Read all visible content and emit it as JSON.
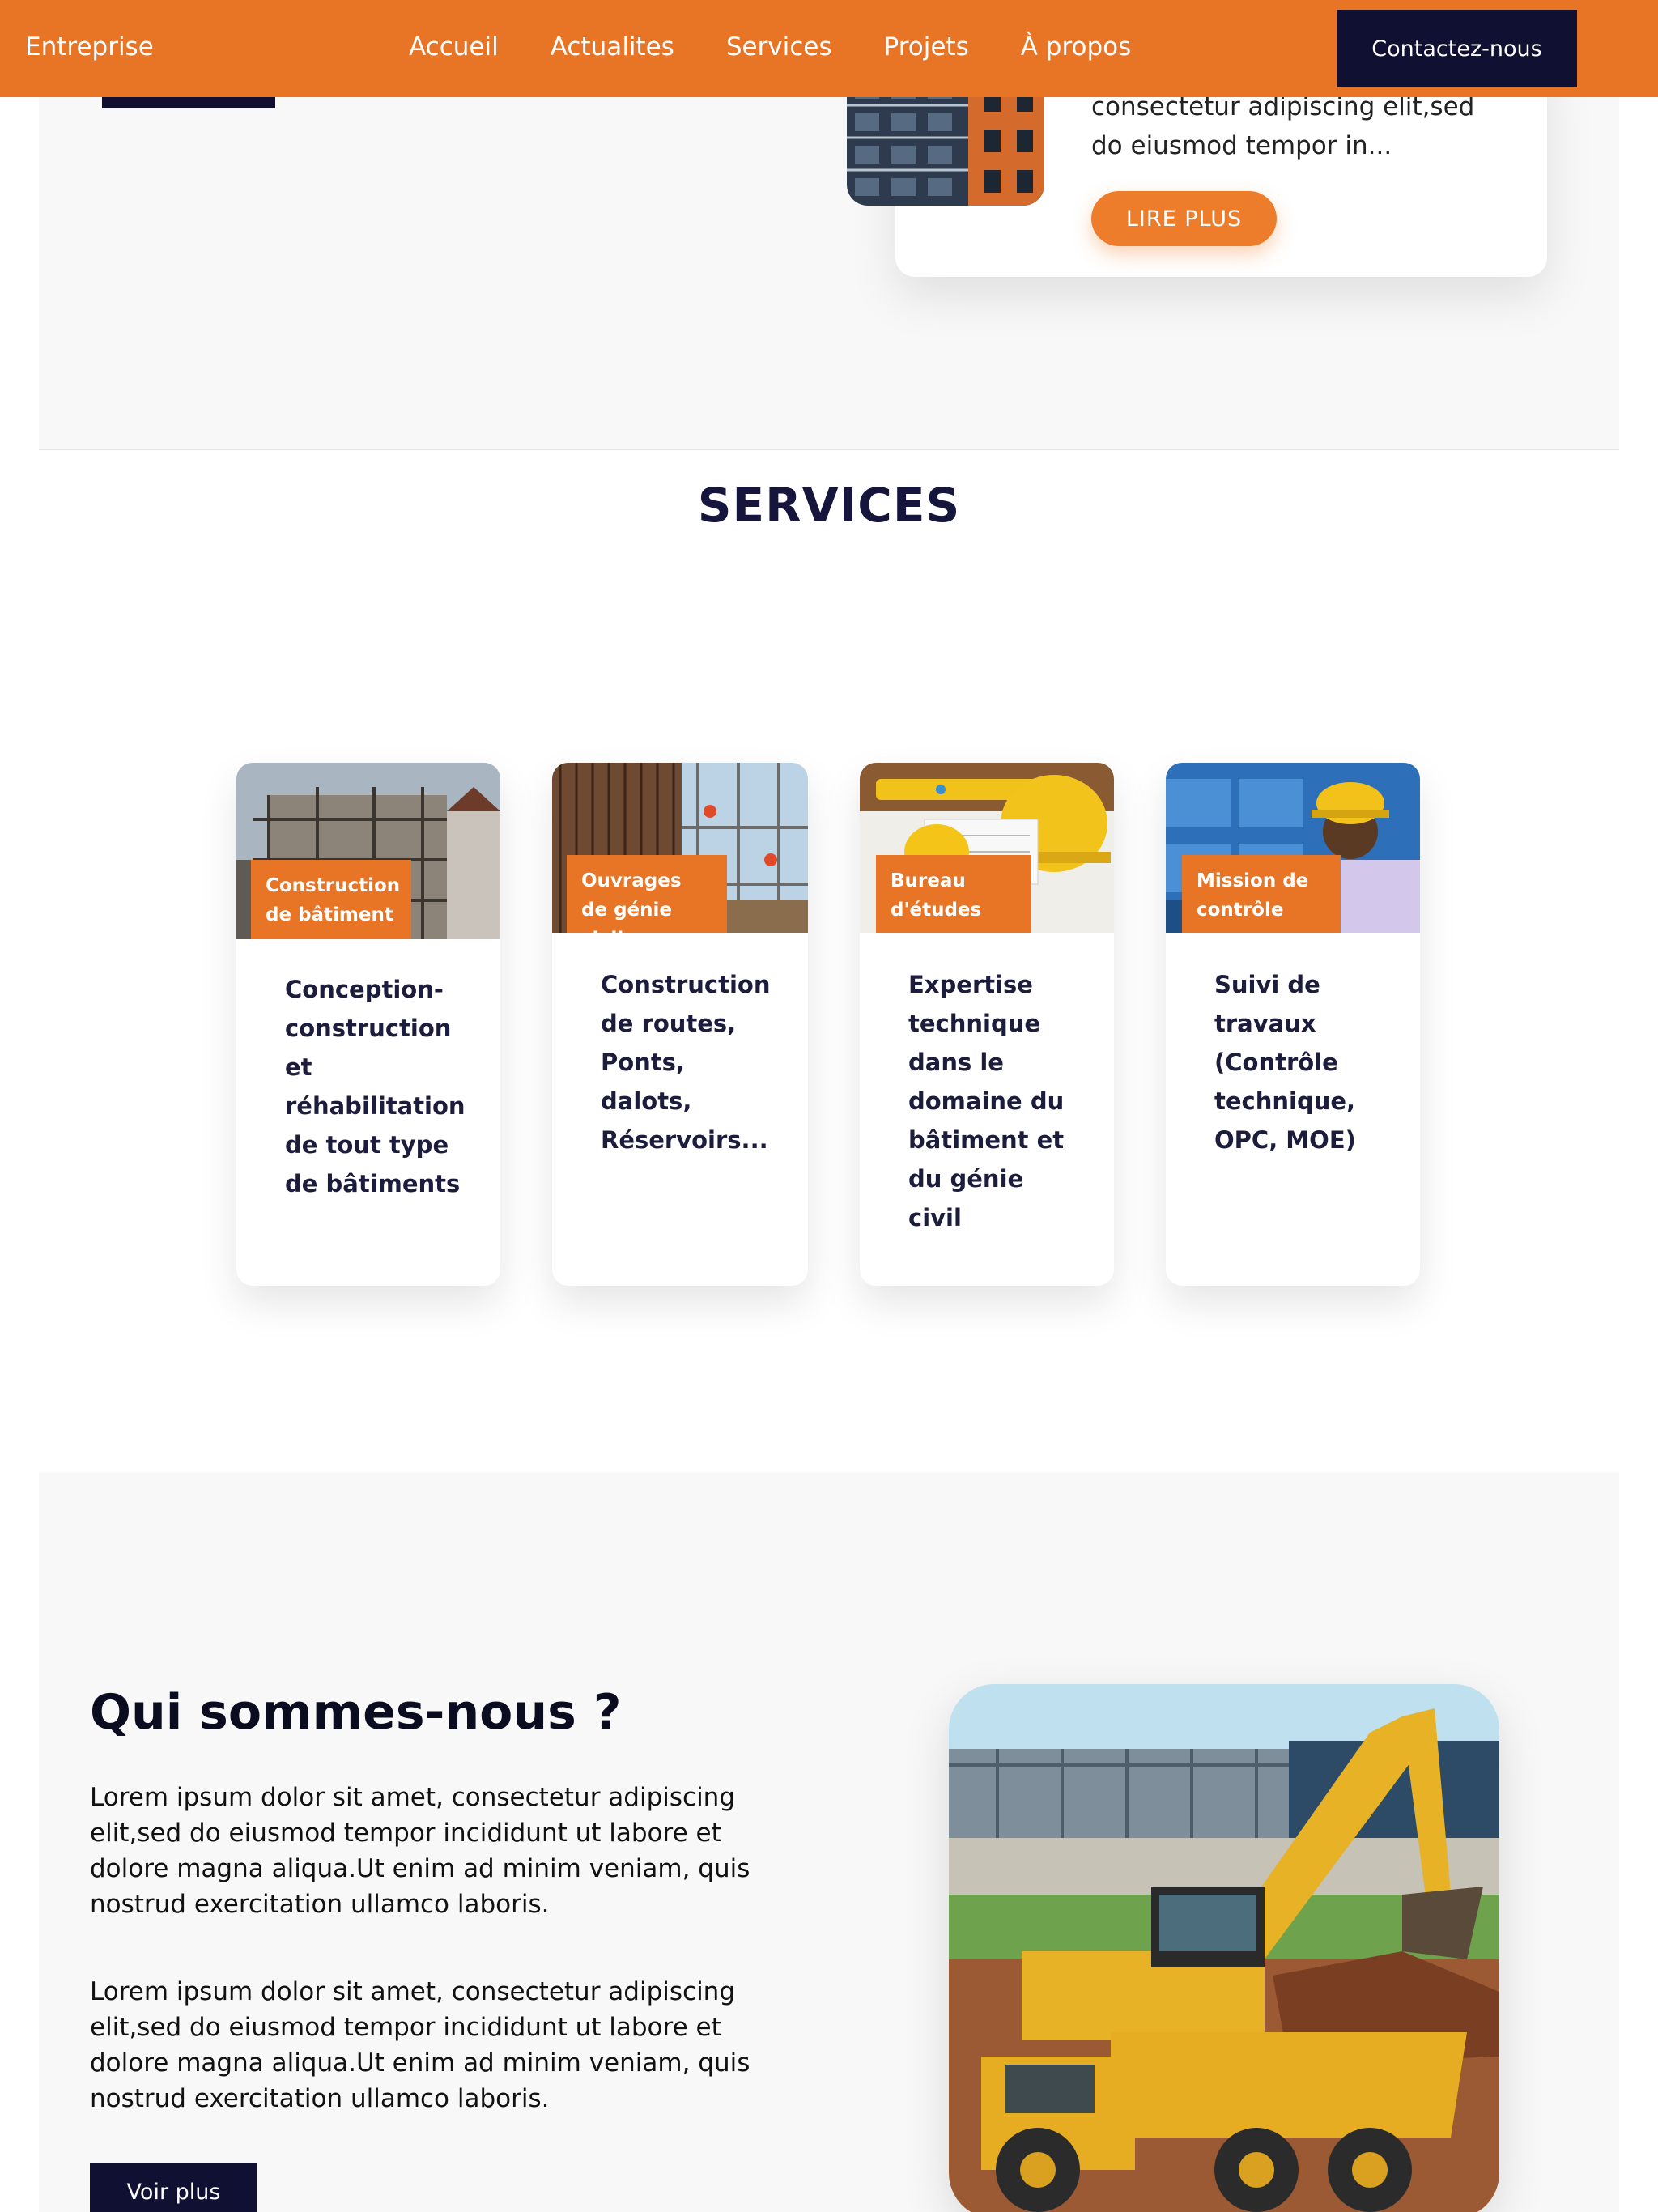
{
  "nav": {
    "brand": "Entreprise",
    "links": [
      "Accueil",
      "Actualites",
      "Services",
      "Projets",
      "À propos"
    ],
    "cta": "Contactez-nous"
  },
  "news": {
    "text": "consectetur adipiscing elit,sed do eiusmod tempor in...",
    "button": "LIRE PLUS"
  },
  "services": {
    "title": "SERVICES",
    "cards": [
      {
        "tag": "Construction de bâtiment",
        "desc": "Conception-construction et réhabilitation de tout type de bâtiments"
      },
      {
        "tag": "Ouvrages de génie civil",
        "desc": "Construction de routes, Ponts, dalots, Réservoirs..."
      },
      {
        "tag": "Bureau d'études",
        "desc": "Expertise technique dans le domaine du bâtiment et du génie civil"
      },
      {
        "tag": "Mission de contrôle",
        "desc": "Suivi de travaux (Contrôle technique, OPC, MOE)"
      }
    ]
  },
  "about": {
    "title": "Qui sommes-nous ?",
    "para1": "Lorem ipsum dolor sit amet, consectetur adipiscing elit,sed do eiusmod tempor incididunt ut labore et dolore magna aliqua.Ut enim ad minim veniam, quis nostrud exercitation ullamco laboris.",
    "para2": "Lorem ipsum dolor sit amet, consectetur adipiscing elit,sed do eiusmod tempor incididunt ut labore et dolore magna aliqua.Ut enim ad minim veniam, quis nostrud exercitation ullamco laboris.",
    "button": "Voir plus"
  },
  "colors": {
    "accent": "#e87425",
    "dark": "#101033",
    "section_bg": "#f8f8f8"
  }
}
